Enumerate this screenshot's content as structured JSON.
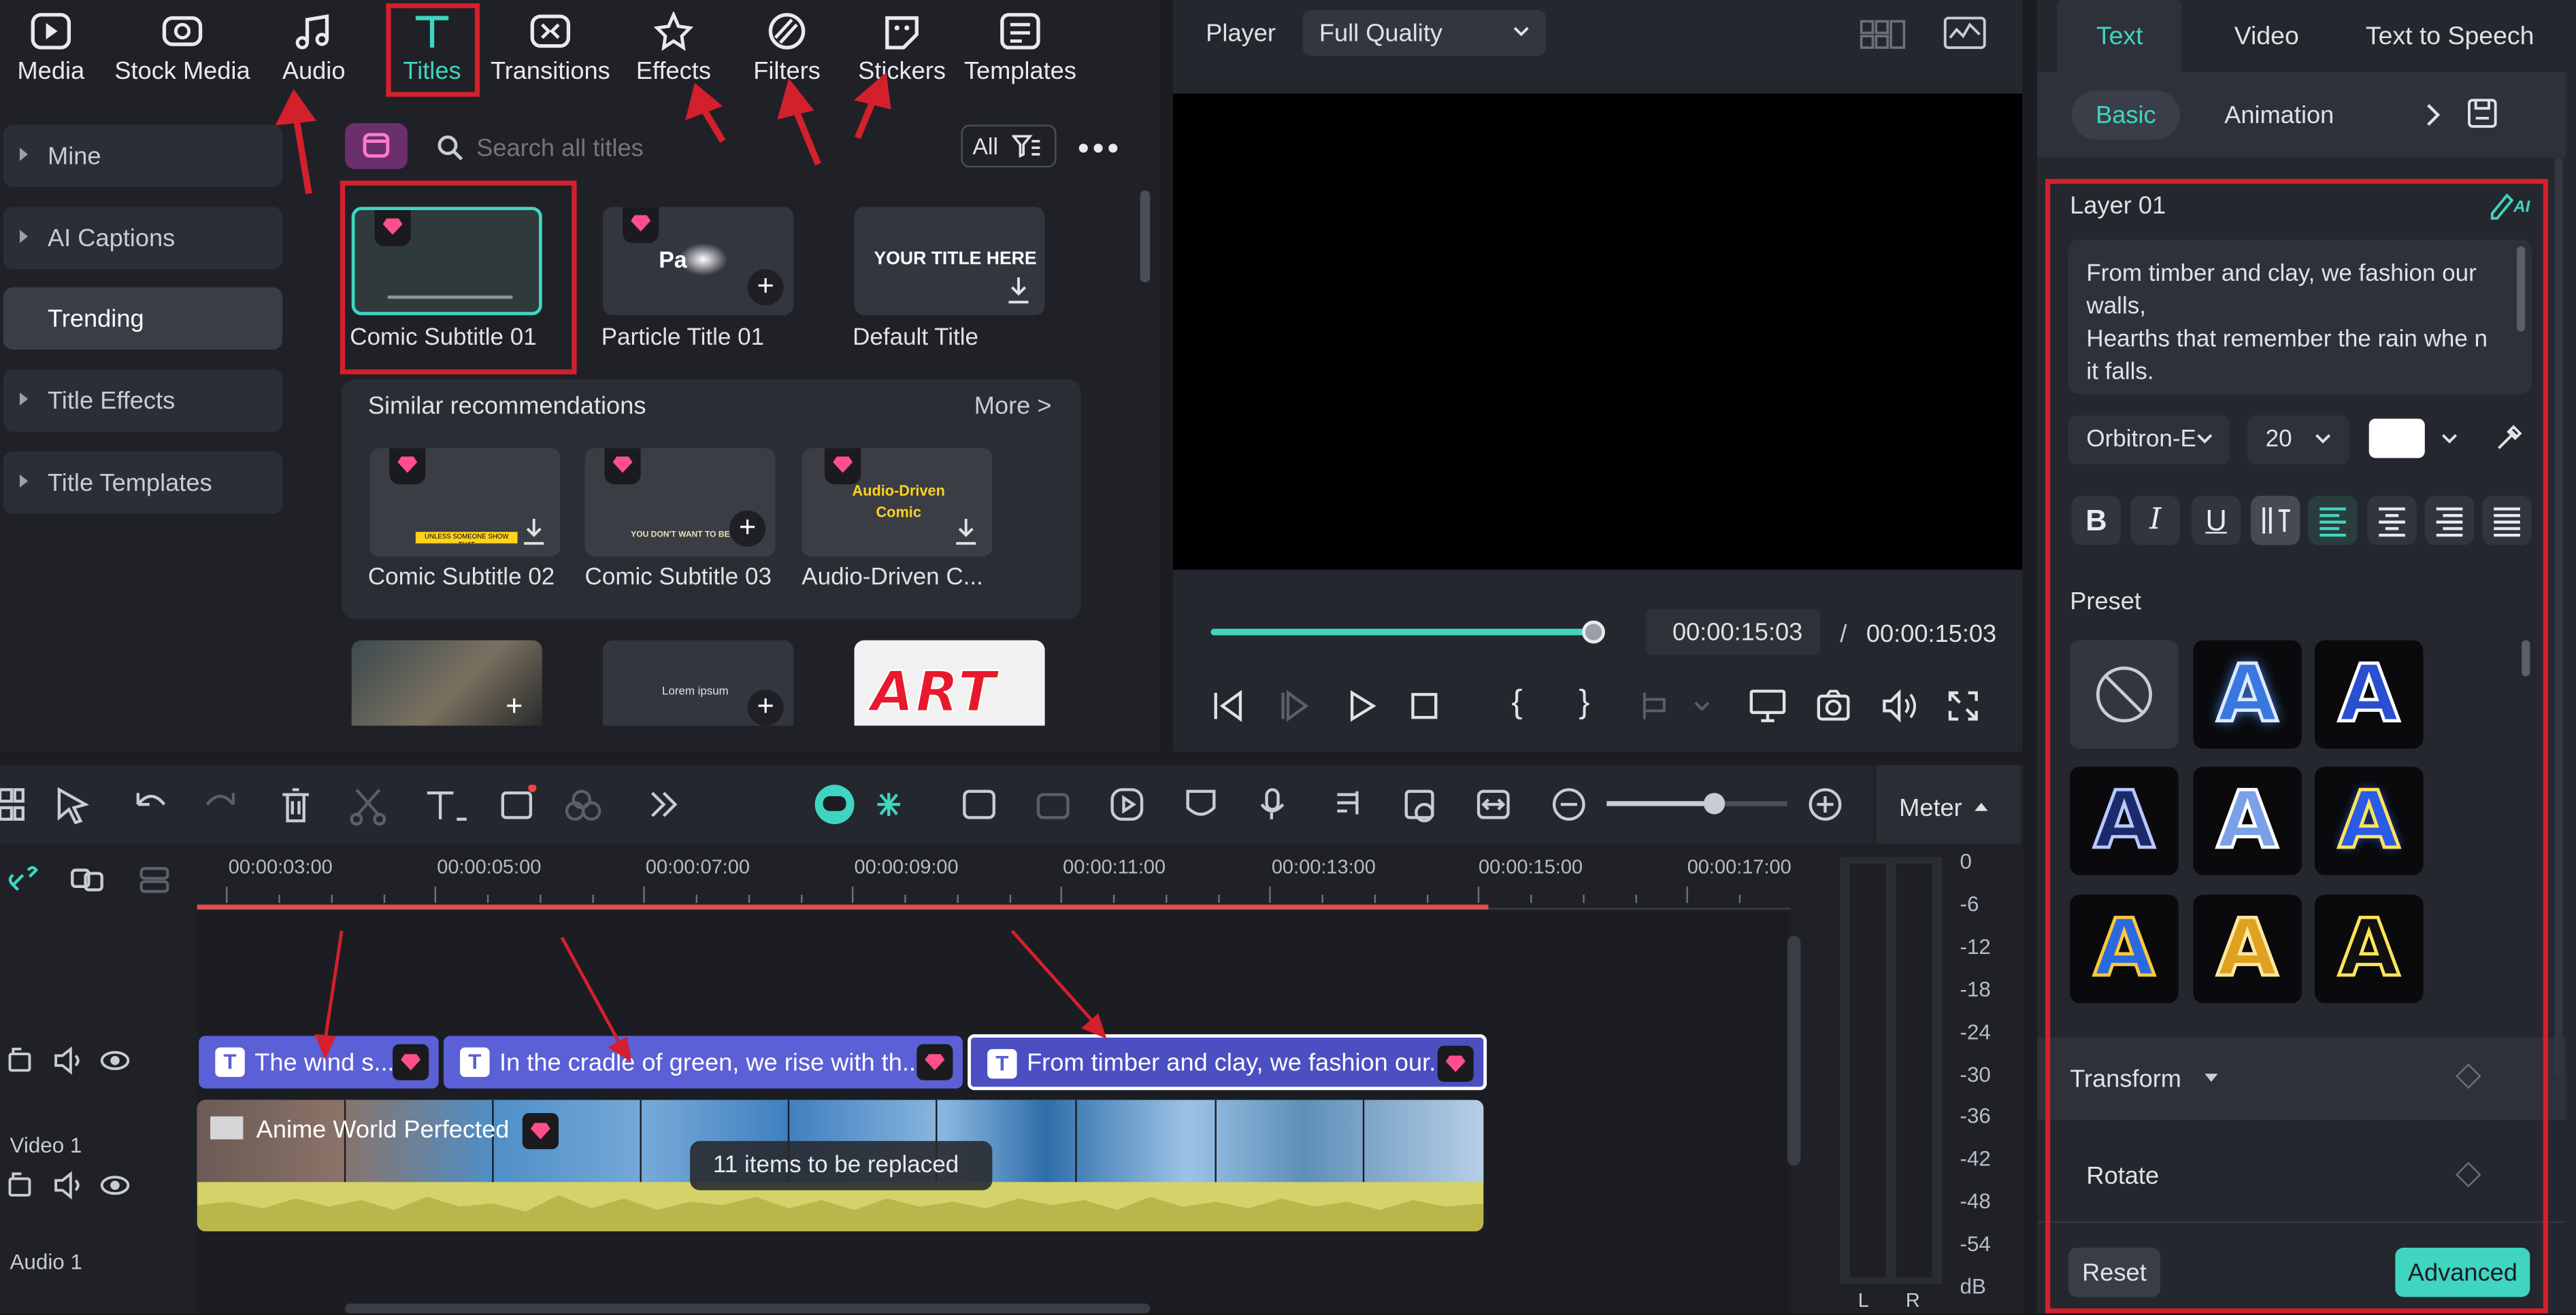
{
  "tabs": [
    {
      "label": "Media",
      "icon": "media-icon"
    },
    {
      "label": "Stock Media",
      "icon": "stock-media-icon"
    },
    {
      "label": "Audio",
      "icon": "music-note-icon"
    },
    {
      "label": "Titles",
      "icon": "titles-icon"
    },
    {
      "label": "Transitions",
      "icon": "transitions-icon"
    },
    {
      "label": "Effects",
      "icon": "effects-icon"
    },
    {
      "label": "Filters",
      "icon": "filters-icon"
    },
    {
      "label": "Stickers",
      "icon": "stickers-icon"
    },
    {
      "label": "Templates",
      "icon": "templates-icon"
    }
  ],
  "sidebar": {
    "items": [
      "Mine",
      "AI Captions",
      "Trending",
      "Title Effects",
      "Title Templates"
    ]
  },
  "search": {
    "placeholder": "Search all titles",
    "filter_label": "All"
  },
  "titles": {
    "items": [
      "Comic Subtitle 01",
      "Particle Title 01",
      "Default Title"
    ],
    "default_card_text": "YOUR TITLE HERE",
    "particle_card_text": "Pa"
  },
  "similar": {
    "heading": "Similar recommendations",
    "more": "More >",
    "items": [
      "Comic Subtitle 02",
      "Comic Subtitle 03",
      "Audio-Driven C..."
    ],
    "card3_text": "Audio-Driven Comic",
    "card2_text": "YOU DON'T WANT TO BE",
    "card1_text": "UNLESS SOMEONE SHOW THAT"
  },
  "more_cards": {
    "lorem": "Lorem ipsum",
    "art": "ART"
  },
  "player": {
    "label": "Player",
    "quality": "Full Quality",
    "current_time": "00:00:15:03",
    "separator": "/",
    "total_time": "00:00:15:03",
    "progress": 1.0
  },
  "timeline": {
    "ruler": [
      "00:00:03:00",
      "00:00:05:00",
      "00:00:07:00",
      "00:00:09:00",
      "00:00:11:00",
      "00:00:13:00",
      "00:00:15:00",
      "00:00:17:00"
    ],
    "meter_label": "Meter",
    "clips": [
      "The wind s...",
      "In the cradle of green, we rise with th...",
      "From timber and clay, we fashion our..."
    ],
    "video_track_label": "Video 1",
    "audio_track_label": "Audio 1",
    "video_clip_title": "Anime World Perfected",
    "replace_badge": "11 items to be replaced",
    "meter_scale": [
      "0",
      "-6",
      "-12",
      "-18",
      "-24",
      "-30",
      "-36",
      "-42",
      "-48",
      "-54",
      "dB"
    ],
    "meter_channels": [
      "L",
      "R"
    ]
  },
  "inspector": {
    "tabs": [
      "Text",
      "Video",
      "Text to Speech"
    ],
    "subtabs": [
      "Basic",
      "Animation"
    ],
    "layer": "Layer 01",
    "ai_badge": "AI",
    "text_content": "From timber and clay, we fashion our walls,\nHearths that remember the rain whe n it falls.",
    "font": "Orbitron-E",
    "size": "20",
    "text_color": "#ffffff",
    "preset_label": "Preset",
    "transform_label": "Transform",
    "rotate_label": "Rotate",
    "reset": "Reset",
    "advanced": "Advanced"
  },
  "colors": {
    "accent": "#3fd5c0",
    "highlight_red": "#d3202d",
    "clip_purple": "#5b60d6",
    "audio_wave": "#d8d870",
    "diamond_pink": "#ff4f8b"
  }
}
